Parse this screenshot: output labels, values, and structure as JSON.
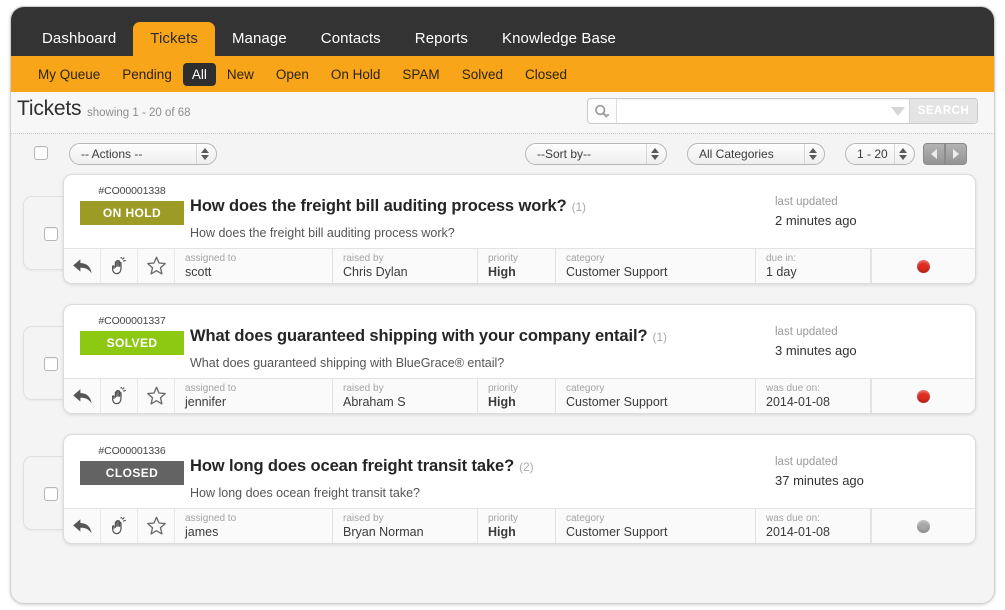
{
  "nav": {
    "tabs": [
      {
        "label": "Dashboard",
        "active": false
      },
      {
        "label": "Tickets",
        "active": true
      },
      {
        "label": "Manage",
        "active": false
      },
      {
        "label": "Contacts",
        "active": false
      },
      {
        "label": "Reports",
        "active": false
      },
      {
        "label": "Knowledge Base",
        "active": false
      }
    ]
  },
  "subnav": {
    "items": [
      {
        "label": "My Queue",
        "active": false
      },
      {
        "label": "Pending",
        "active": false
      },
      {
        "label": "All",
        "active": true
      },
      {
        "label": "New",
        "active": false
      },
      {
        "label": "Open",
        "active": false
      },
      {
        "label": "On Hold",
        "active": false
      },
      {
        "label": "SPAM",
        "active": false
      },
      {
        "label": "Solved",
        "active": false
      },
      {
        "label": "Closed",
        "active": false
      }
    ]
  },
  "header": {
    "title": "Tickets",
    "subtitle": "showing 1 - 20 of 68"
  },
  "search": {
    "value": "",
    "placeholder": "",
    "button_label": "SEARCH"
  },
  "toolbar": {
    "actions_select": "-- Actions --",
    "sort_select": "--Sort by--",
    "categories_select": "All Categories",
    "range_select": "1 - 20"
  },
  "meta_labels": {
    "assigned_to": "assigned to",
    "raised_by": "raised by",
    "priority": "priority",
    "category": "category",
    "last_updated": "last updated"
  },
  "colors": {
    "brand_orange": "#f9a51a",
    "nav_dark": "#333333",
    "badge_onhold": "#9b9b26",
    "badge_solved": "#8dc813",
    "badge_closed": "#636363",
    "dot_red": "#e02b20",
    "dot_grey": "#a8a8a8"
  },
  "tickets": [
    {
      "id": "#CO00001338",
      "status": "ON HOLD",
      "status_class": "onhold",
      "title": "How does the freight bill auditing process work?",
      "count": "(1)",
      "description": "How does the freight bill auditing process work?",
      "updated_label": "last updated",
      "updated_value": "2 minutes ago",
      "assigned_to": "scott",
      "raised_by": "Chris Dylan",
      "priority": "High",
      "category": "Customer Support",
      "due_label": "due in:",
      "due_value": "1 day",
      "dot": "red"
    },
    {
      "id": "#CO00001337",
      "status": "SOLVED",
      "status_class": "solved",
      "title": "What does guaranteed shipping with your company entail?",
      "count": "(1)",
      "description": "What does guaranteed shipping with BlueGrace® entail?",
      "updated_label": "last updated",
      "updated_value": "3 minutes ago",
      "assigned_to": "jennifer",
      "raised_by": "Abraham S",
      "priority": "High",
      "category": "Customer Support",
      "due_label": "was due on:",
      "due_value": "2014-01-08",
      "dot": "red"
    },
    {
      "id": "#CO00001336",
      "status": "CLOSED",
      "status_class": "closed",
      "title": "How long does ocean freight transit take?",
      "count": "(2)",
      "description": "How long does ocean freight transit take?",
      "updated_label": "last updated",
      "updated_value": "37 minutes ago",
      "assigned_to": "james",
      "raised_by": "Bryan Norman",
      "priority": "High",
      "category": "Customer Support",
      "due_label": "was due on:",
      "due_value": "2014-01-08",
      "dot": "grey"
    }
  ]
}
